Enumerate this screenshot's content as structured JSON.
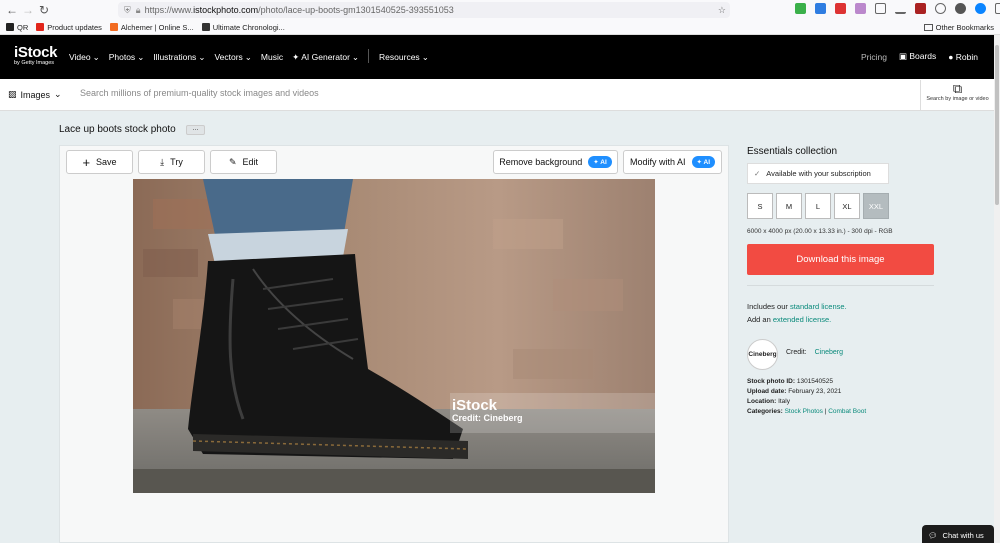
{
  "browser": {
    "url_prefix": "https://www.",
    "url_domain": "istockphoto.com",
    "url_path": "/photo/lace-up-boots-gm1301540525-393551053",
    "bookmarks": [
      "QR",
      "Product updates",
      "Alchemer | Online S...",
      "Ultimate Chronologi..."
    ],
    "other_bookmarks": "Other Bookmarks"
  },
  "nav": {
    "logo": "iStock",
    "logo_sub": "by Getty Images",
    "menu": [
      "Video",
      "Photos",
      "Illustrations",
      "Vectors",
      "Music",
      "AI Generator",
      "Resources"
    ],
    "pricing": "Pricing",
    "boards": "Boards",
    "user": "Robin"
  },
  "search": {
    "type": "Images",
    "placeholder": "Search millions of premium-quality stock images and videos",
    "by_image": "Search by image or video"
  },
  "page": {
    "title": "Lace up boots stock photo",
    "more": "...",
    "toolbar": {
      "save": "Save",
      "try": "Try",
      "edit": "Edit",
      "remove_bg": "Remove background",
      "modify": "Modify with AI",
      "ai": "AI"
    },
    "watermark": "iStock",
    "watermark_credit": "Credit: Cineberg"
  },
  "side": {
    "collection": "Essentials collection",
    "availability": "Available with your subscription",
    "sizes": [
      "S",
      "M",
      "L",
      "XL",
      "XXL"
    ],
    "selected_size": "XXL",
    "dimensions": "6000 x 4000 px (20.00 x 13.33 in.) - 300 dpi - RGB",
    "download": "Download this image",
    "includes": "Includes our",
    "standard_license": "standard license.",
    "add_an": "Add an",
    "extended_license": "extended license.",
    "contributor_logo": "Cineberg",
    "credit_label": "Credit:",
    "credit_name": "Cineberg",
    "stock_id_label": "Stock photo ID:",
    "stock_id": "1301540525",
    "upload_label": "Upload date:",
    "upload_date": "February 23, 2021",
    "location_label": "Location:",
    "location": "Italy",
    "categories_label": "Categories:",
    "categories": [
      "Stock Photos",
      "Combat Boot"
    ]
  },
  "chat": "Chat with us",
  "colors": {
    "download": "#f24b42",
    "link": "#0a8a7b",
    "ai": "#1f8fff"
  }
}
